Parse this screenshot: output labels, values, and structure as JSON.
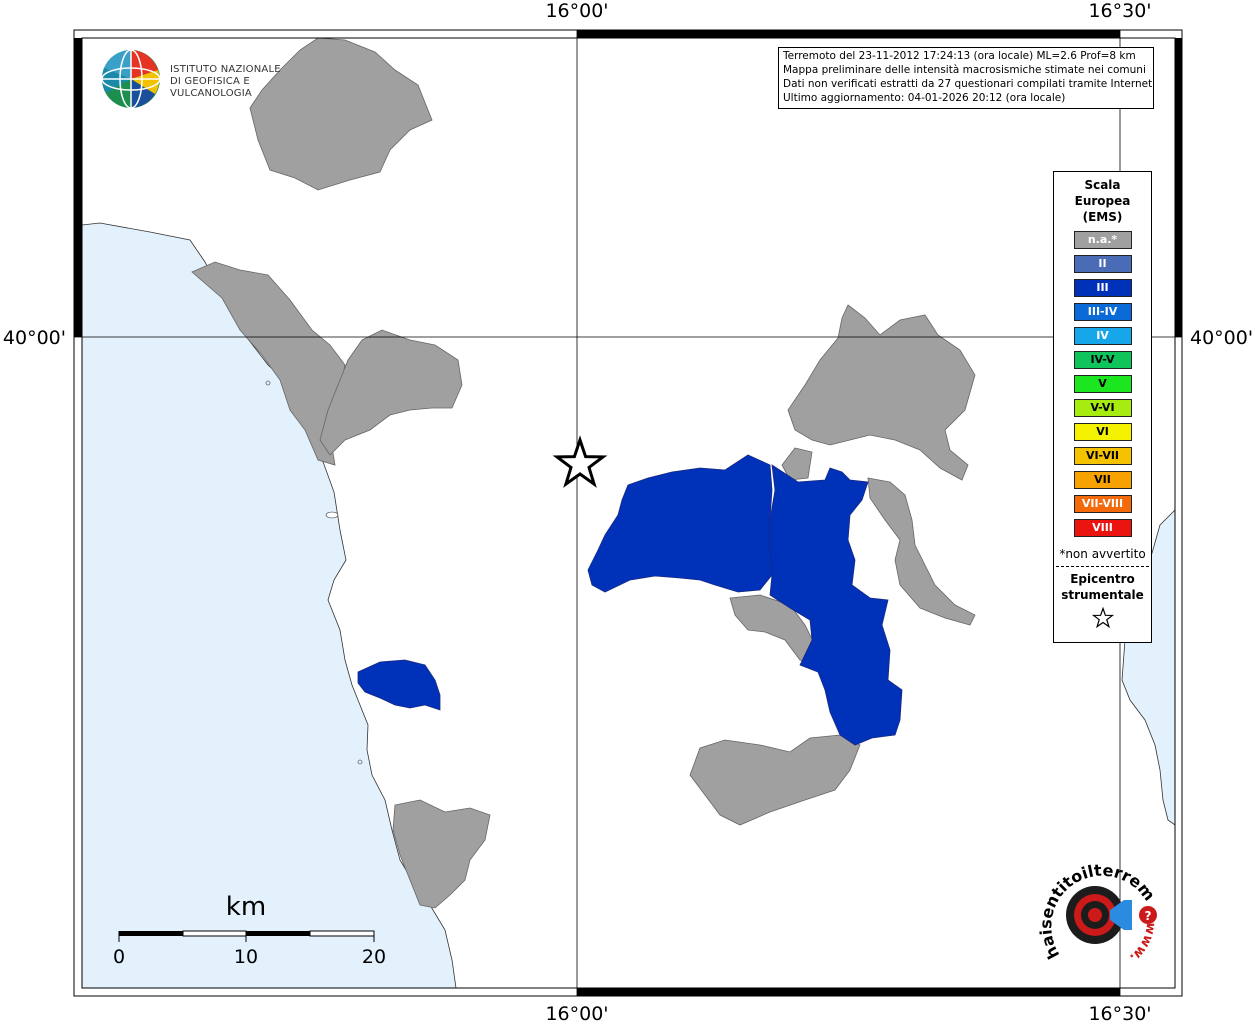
{
  "map": {
    "lon_ticks": [
      "16°00'",
      "16°30'"
    ],
    "lat_ticks": [
      "40°00'"
    ],
    "colors": {
      "sea": "#e2f1fb",
      "land": "#ffffff",
      "na": "#a0a0a0",
      "intensity_III": "#0031b9",
      "frame": "#000000"
    },
    "epicenter_icon": "star-icon"
  },
  "info": {
    "line1": "Terremoto del 23-11-2012 17:24:13 (ora locale) ML=2.6 Prof=8 km",
    "line2": "Mappa preliminare delle intensità macrosismiche stimate nei comuni",
    "line3": "Dati non verificati estratti da 27 questionari compilati tramite Internet.",
    "line4": "Ultimo aggiornamento: 04-01-2026 20:12 (ora locale)"
  },
  "logo": {
    "line1": "ISTITUTO NAZIONALE",
    "line2": "DI GEOFISICA E VULCANOLOGIA",
    "icon": "globe-icon"
  },
  "legend": {
    "title_lines": [
      "Scala",
      "Europea",
      "(EMS)"
    ],
    "items": [
      {
        "label": "n.a.*",
        "color": "#a0a0a0"
      },
      {
        "label": "II",
        "color": "#4a6bb5"
      },
      {
        "label": "III",
        "color": "#0031b9"
      },
      {
        "label": "III-IV",
        "color": "#0b6bd6"
      },
      {
        "label": "IV",
        "color": "#16a6ea"
      },
      {
        "label": "IV-V",
        "color": "#10c45c"
      },
      {
        "label": "V",
        "color": "#1be620"
      },
      {
        "label": "V-VI",
        "color": "#a6ec10"
      },
      {
        "label": "VI",
        "color": "#f4f200"
      },
      {
        "label": "VI-VII",
        "color": "#f5c200"
      },
      {
        "label": "VII",
        "color": "#f7a200"
      },
      {
        "label": "VII-VIII",
        "color": "#f46a0a"
      },
      {
        "label": "VIII",
        "color": "#ec1410"
      }
    ],
    "note": "*non avvertito",
    "epicenter_lines": [
      "Epicentro",
      "strumentale"
    ],
    "epicenter_icon": "star-icon"
  },
  "scale": {
    "unit": "km",
    "ticks": [
      "0",
      "10",
      "20"
    ]
  },
  "badge": {
    "text": "haisentitoilterremoto.it",
    "prefix": "www.",
    "icon": "target-icon"
  }
}
